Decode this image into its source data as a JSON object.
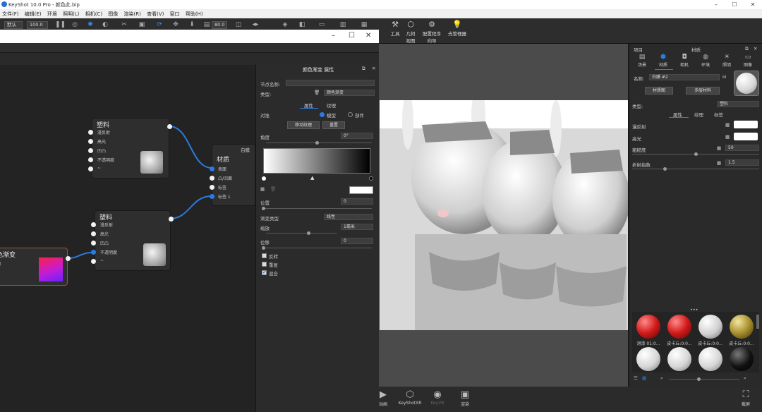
{
  "titlebar": {
    "title": "KeyShot 10.0 Pro - 颜色此.bip"
  },
  "menubar": [
    "文件(F)",
    "编辑(E)",
    "环境",
    "照明(L)",
    "相机(C)",
    "图像",
    "渲染(R)",
    "查看(V)",
    "窗口",
    "帮助(H)"
  ],
  "toolbar": {
    "preset": "默认",
    "zoom": "100.0",
    "fov": "80.0",
    "tools": [
      {
        "icon": "tools-icon",
        "label": "工具"
      },
      {
        "icon": "geometry-view-icon",
        "label": "几何\n视图"
      },
      {
        "icon": "config-icon",
        "label": "配置程序\n向导"
      },
      {
        "icon": "light-manager-icon",
        "label": "光管理器"
      }
    ]
  },
  "graph": {
    "nodes": {
      "plastic1": {
        "title": "塑料",
        "ports": [
          "漫反射",
          "高光",
          "凹凸",
          "不透明度",
          "~"
        ]
      },
      "plastic2": {
        "title": "塑料",
        "ports": [
          "漫反射",
          "高光",
          "凹凸",
          "不透明度",
          "~"
        ]
      },
      "material": {
        "title": "材质",
        "header": "白膜",
        "ports": [
          "表面",
          "凸/凹面",
          "标签",
          "标签 1"
        ]
      },
      "gradient": {
        "title": "色渐变",
        "sub": "图"
      }
    }
  },
  "props": {
    "title": "颜色渐变 属性",
    "node_name_label": "节点名称:",
    "type_label": "类型:",
    "type_value": "颜色渐变",
    "tab_props": "属性",
    "tab_texture": "纹理",
    "map_label": "对准",
    "opt_model": "模型",
    "opt_part": "部件",
    "move_texture": "移动纹理",
    "reset": "重置",
    "angle_label": "角度",
    "angle_value": "0°",
    "position_label": "位置",
    "position_value": "0",
    "gradient_type_label": "渐变类型",
    "gradient_type_value": "线性",
    "scale_label": "缩放",
    "scale_value": "1毫米",
    "shift_label": "位移",
    "shift_value": "0",
    "invert_label": "反转",
    "repeat_label": "重复",
    "blend_label": "混合"
  },
  "bottombar": [
    {
      "icon": "animation-icon",
      "label": "动画"
    },
    {
      "icon": "keyshotxr-icon",
      "label": "KeyShotXR"
    },
    {
      "icon": "keyvr-icon",
      "label": "KeyVR"
    },
    {
      "icon": "render-icon",
      "label": "渲染"
    },
    {
      "icon": "screenshot-icon",
      "label": "截屏"
    }
  ],
  "rpanel": {
    "header_left": "项目",
    "header_right": "材质",
    "tabs": [
      {
        "icon": "scene-icon",
        "label": "场景"
      },
      {
        "icon": "material-icon",
        "label": "材质"
      },
      {
        "icon": "camera-icon",
        "label": "相机"
      },
      {
        "icon": "environment-icon",
        "label": "环境"
      },
      {
        "icon": "lighting-icon",
        "label": "照明"
      },
      {
        "icon": "image-icon",
        "label": "图像"
      }
    ],
    "name_label": "名称:",
    "name_value": "白膜 #2",
    "graph_btn": "材质图",
    "multi_btn": "多层材料",
    "type_label": "类型:",
    "type_value": "塑料",
    "sub_tabs": [
      "属性",
      "纹理",
      "标签"
    ],
    "diffuse_label": "漫反射",
    "specular_label": "高光",
    "roughness_label": "粗糙度",
    "roughness_value": "50",
    "ior_label": "折射指数",
    "ior_value": "1.5",
    "library": [
      {
        "label": "测漆 01:0...",
        "color": "red"
      },
      {
        "label": "皮卡丘:0:0...",
        "color": "red"
      },
      {
        "label": "皮卡丘:0:0...",
        "color": "white"
      },
      {
        "label": "皮卡丘:0:0...",
        "color": "gold"
      },
      {
        "label": "",
        "color": "white"
      },
      {
        "label": "",
        "color": "white"
      },
      {
        "label": "",
        "color": "white"
      },
      {
        "label": "",
        "color": "black"
      }
    ]
  },
  "colors": {
    "accent": "#2a7be0",
    "wire": "#2a7be0"
  }
}
